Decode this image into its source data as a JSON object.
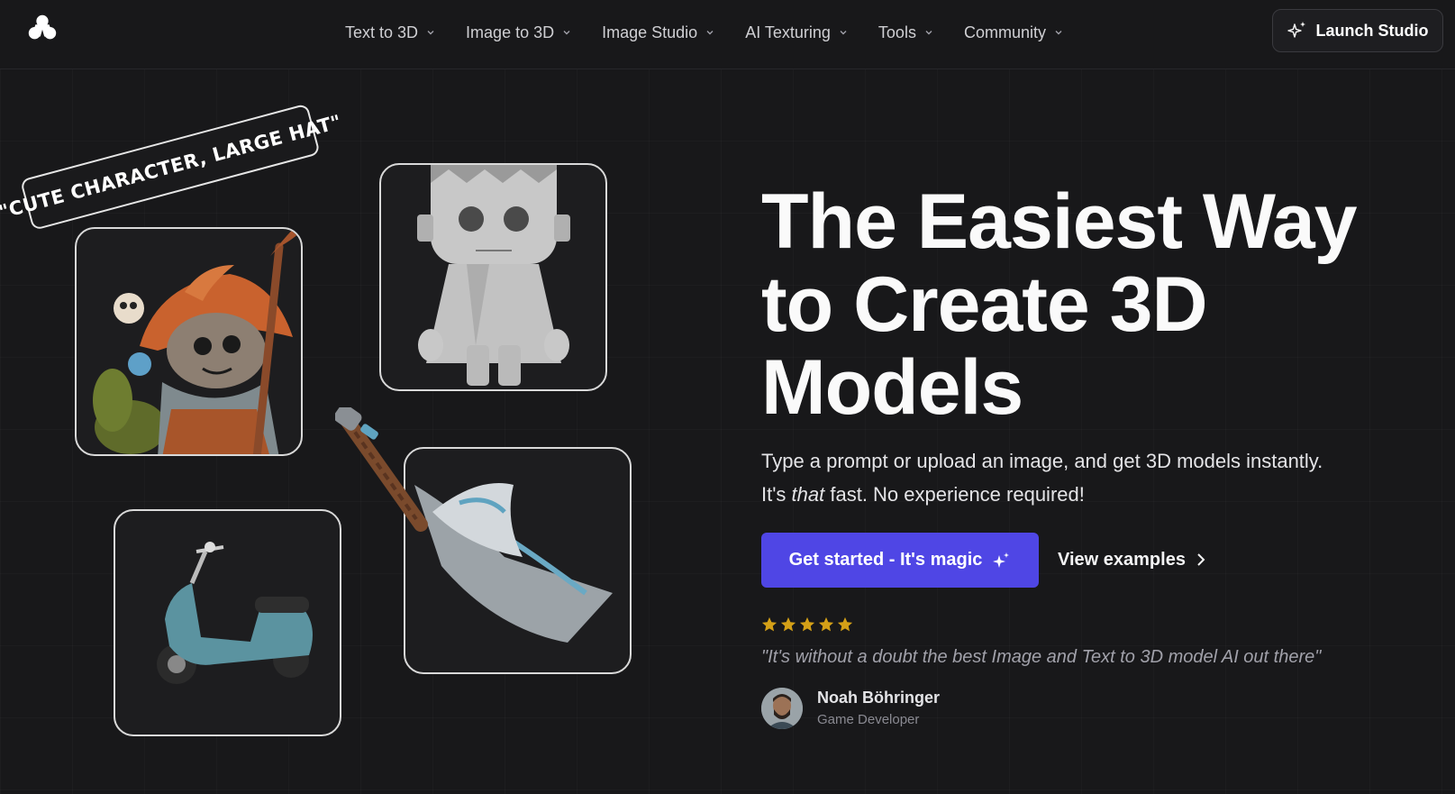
{
  "nav": {
    "logo": "logo-icon",
    "items": [
      {
        "label": "Text to 3D"
      },
      {
        "label": "Image to 3D"
      },
      {
        "label": "Image Studio"
      },
      {
        "label": "AI Texturing"
      },
      {
        "label": "Tools"
      },
      {
        "label": "Community"
      }
    ],
    "launch_label": "Launch Studio",
    "launch_icon": "sparkle-icon"
  },
  "showcase": {
    "prompt_tag": "\"CUTE CHARACTER, LARGE HAT\""
  },
  "hero": {
    "title": "The Easiest Way to Create 3D Models",
    "subtitle_1": "Type a prompt or upload an image, and get 3D models instantly.",
    "subtitle_2_pre": "It's ",
    "subtitle_2_em": "that",
    "subtitle_2_post": " fast. No experience required!",
    "cta_label": "Get started - It's magic",
    "cta_color": "#4f46e5",
    "secondary_label": "View examples"
  },
  "testimonial": {
    "rating": 5,
    "star_color": "#d4a017",
    "quote": "\"It's without a doubt the best Image and Text to 3D model AI out there\"",
    "author_name": "Noah Böhringer",
    "author_role": "Game Developer"
  }
}
